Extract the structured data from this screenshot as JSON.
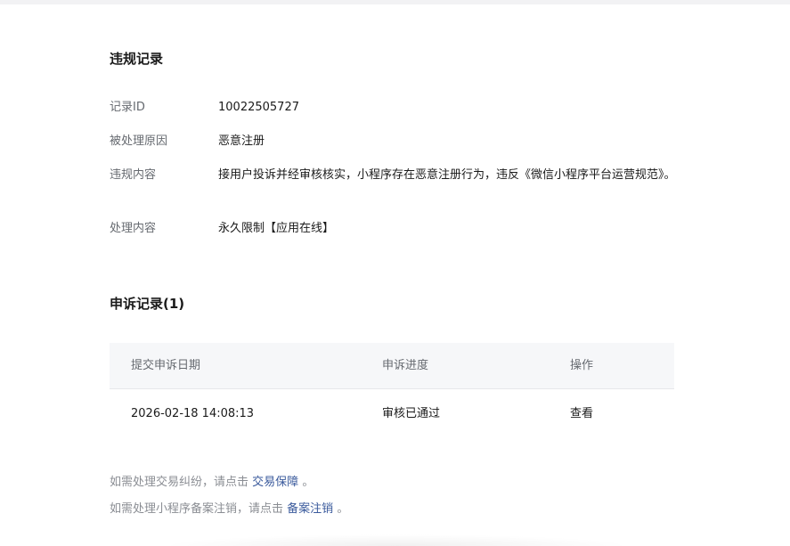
{
  "violation": {
    "title": "违规记录",
    "rows": [
      {
        "label": "记录ID",
        "value": "10022505727"
      },
      {
        "label": "被处理原因",
        "value": "恶意注册"
      },
      {
        "label": "违规内容",
        "value": "接用户投诉并经审核核实，小程序存在恶意注册行为，违反《微信小程序平台运营规范》。"
      },
      {
        "label": "处理内容",
        "value": "永久限制【应用在线】"
      }
    ]
  },
  "appeal": {
    "title": "申诉记录(1)",
    "headers": {
      "date": "提交申诉日期",
      "progress": "申诉进度",
      "action": "操作"
    },
    "rows": [
      {
        "date": "2026-02-18 14:08:13",
        "progress": "审核已通过",
        "action": "查看"
      }
    ]
  },
  "notes": {
    "dispute_prefix": "如需处理交易纠纷，请点击",
    "dispute_link": "交易保障",
    "dispute_suffix": "。",
    "cancel_prefix": "如需处理小程序备案注销，请点击",
    "cancel_link": "备案注销",
    "cancel_suffix": "。"
  }
}
